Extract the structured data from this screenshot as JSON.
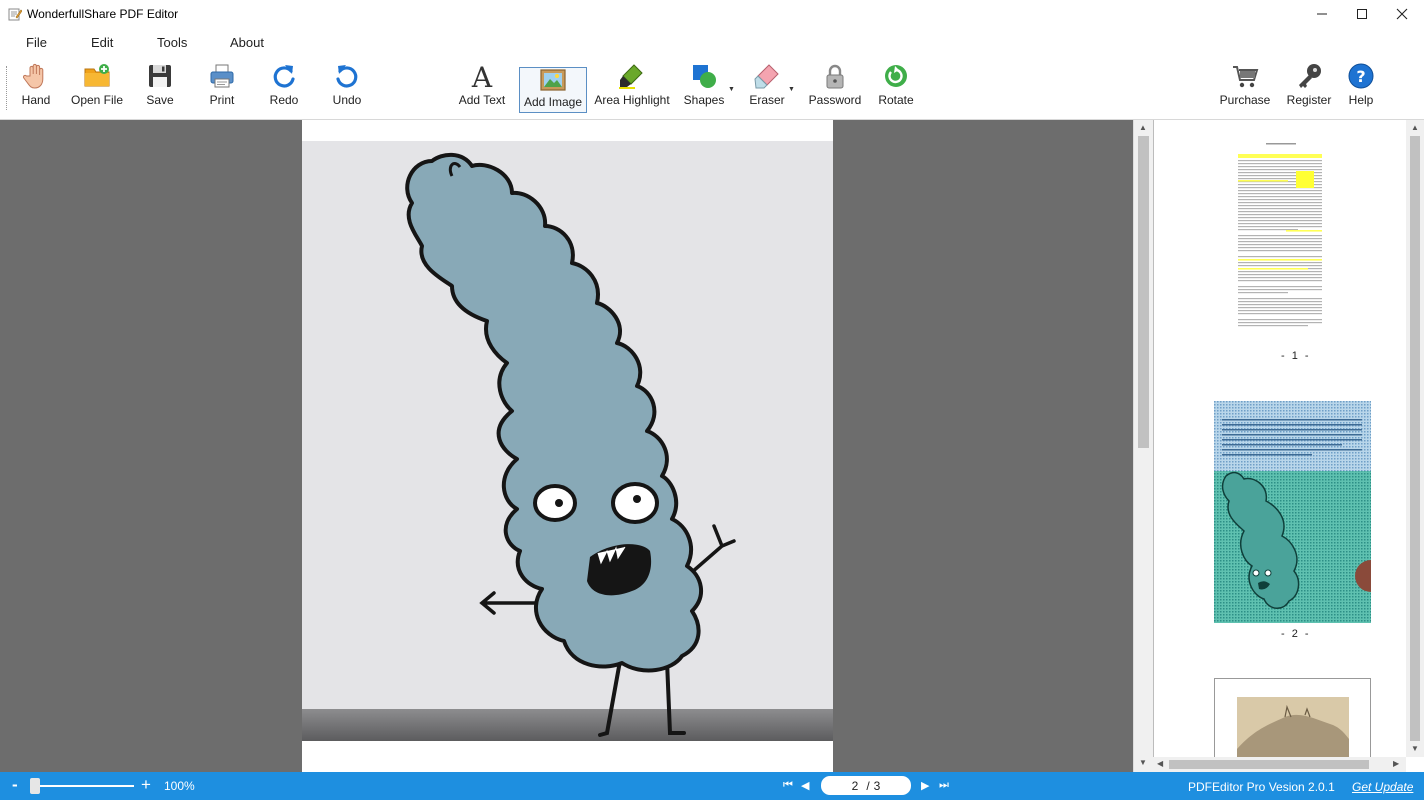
{
  "window": {
    "title": "WonderfullShare PDF Editor",
    "minimize_glyph": "—",
    "maximize_glyph": "☐",
    "close_glyph": "✕"
  },
  "menu": {
    "file": "File",
    "edit": "Edit",
    "tools": "Tools",
    "about": "About"
  },
  "toolbar": {
    "hand": "Hand",
    "open_file": "Open File",
    "save": "Save",
    "print": "Print",
    "redo": "Redo",
    "undo": "Undo",
    "add_text": "Add Text",
    "add_image": "Add Image",
    "area_highlight": "Area Highlight",
    "shapes": "Shapes",
    "eraser": "Eraser",
    "password": "Password",
    "rotate": "Rotate",
    "purchase": "Purchase",
    "register": "Register",
    "help": "Help",
    "active_tool": "Add Image"
  },
  "thumbnails": [
    {
      "label": "- 1 -"
    },
    {
      "label": "- 2 -"
    }
  ],
  "status": {
    "zoom_out": "-",
    "zoom_in": "+",
    "zoom": "100%",
    "zoom_level_fraction": 0.05,
    "first_page": "⏮",
    "prev_page": "◀",
    "next_page": "▶",
    "last_page": "⏭",
    "current_page": "2",
    "page_sep": "/",
    "total_pages": "3",
    "version": "PDFEditor Pro Vesion 2.0.1",
    "get_update": "Get Update"
  },
  "colors": {
    "accent": "#1e8fe0",
    "workspace": "#6d6d6d",
    "highlight": "#ffff33"
  },
  "icons": {
    "hand": "hand-icon",
    "open_file": "folder-icon",
    "save": "floppy-icon",
    "print": "printer-icon",
    "redo": "redo-icon",
    "undo": "undo-icon",
    "add_text": "letter-a-icon",
    "add_image": "picture-icon",
    "area_highlight": "marker-icon",
    "shapes": "shapes-icon",
    "eraser": "eraser-icon",
    "password": "padlock-icon",
    "rotate": "rotate-icon",
    "purchase": "cart-icon",
    "register": "key-icon",
    "help": "help-icon"
  }
}
